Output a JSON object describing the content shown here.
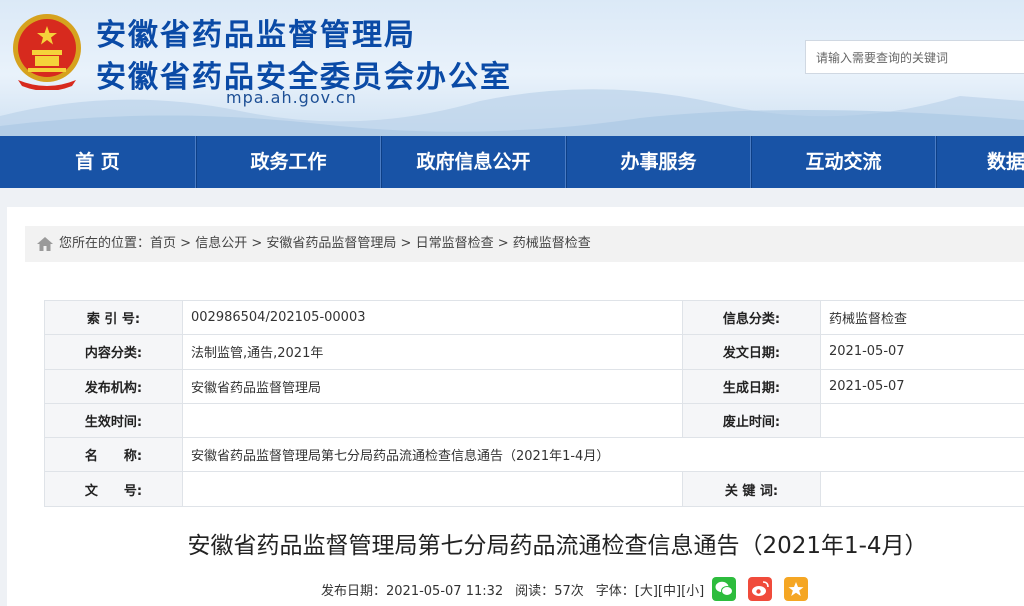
{
  "header": {
    "title_main": "安徽省药品监督管理局",
    "title_sub": "安徽省药品安全委员会办公室",
    "domain": "mpa.ah.gov.cn",
    "search_placeholder": "请输入需要查询的关键词"
  },
  "nav": {
    "items": [
      "首 页",
      "政务工作",
      "政府信息公开",
      "办事服务",
      "互动交流",
      "数据"
    ]
  },
  "breadcrumb": {
    "prefix": "您所在的位置：",
    "path": [
      "首页",
      "信息公开",
      "安徽省药品监督管理局",
      "日常监督检查",
      "药械监督检查"
    ],
    "separator": " > "
  },
  "meta": {
    "index_no_label": "索 引 号:",
    "index_no": "002986504/202105-00003",
    "info_category_label": "信息分类:",
    "info_category": "药械监督检查",
    "content_category_label": "内容分类:",
    "content_category": "法制监管,通告,2021年",
    "issue_date_label": "发文日期:",
    "issue_date": "2021-05-07",
    "publisher_label": "发布机构:",
    "publisher": "安徽省药品监督管理局",
    "created_date_label": "生成日期:",
    "created_date": "2021-05-07",
    "effective_label": "生效时间:",
    "effective": "",
    "expiry_label": "废止时间:",
    "expiry": "",
    "name_label": "名　　称:",
    "name": "安徽省药品监督管理局第七分局药品流通检查信息通告（2021年1-4月）",
    "doc_no_label": "文　　号:",
    "doc_no": "",
    "keywords_label": "关 键 词:",
    "keywords": ""
  },
  "article": {
    "title": "安徽省药品监督管理局第七分局药品流通检查信息通告（2021年1-4月）",
    "publish_label": "发布日期：",
    "publish_time": "2021-05-07 11:32",
    "reads_label": "阅读：",
    "reads": "57次",
    "font_label": "字体：",
    "font_large": "[大]",
    "font_medium": "[中]",
    "font_small": "[小]"
  },
  "share_icons": [
    "wechat-icon",
    "weibo-icon",
    "favorite-icon"
  ],
  "colors": {
    "nav_bg": "#1853a6",
    "title_blue": "#0a4aa6",
    "wechat": "#2dbc3d",
    "weibo": "#f04b3b",
    "favorite": "#f5a623"
  }
}
